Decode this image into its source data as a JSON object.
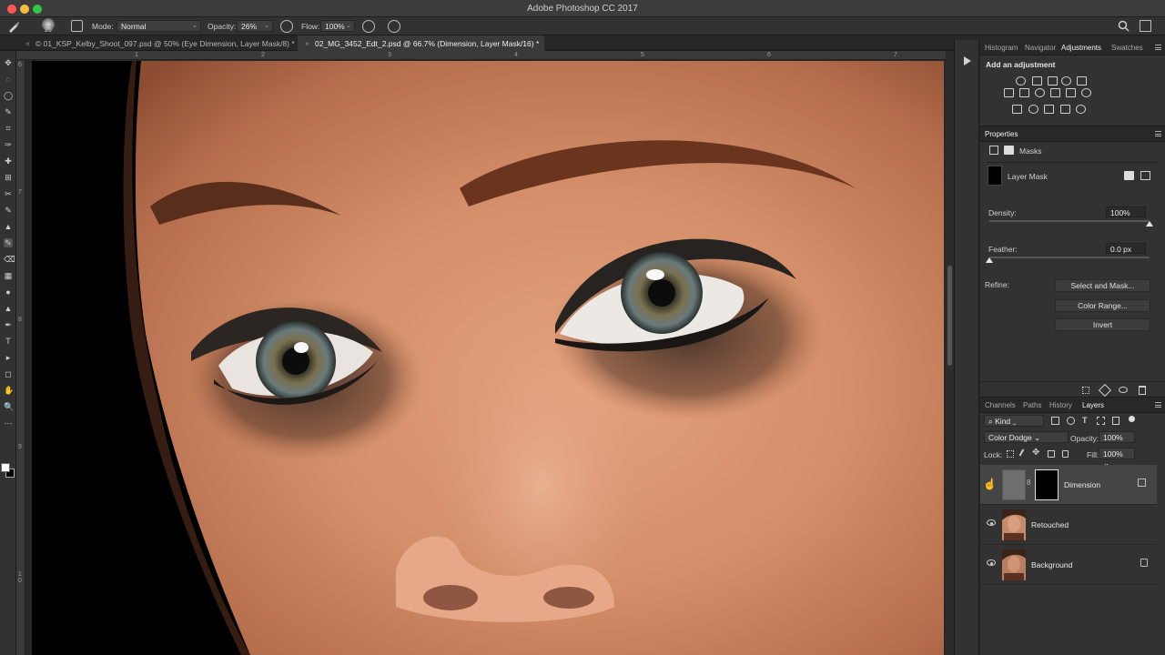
{
  "app": {
    "title": "Adobe Photoshop CC 2017"
  },
  "options_bar": {
    "brush_size": "25",
    "mode_label": "Mode:",
    "mode_value": "Normal",
    "opacity_label": "Opacity:",
    "opacity_value": "26%",
    "flow_label": "Flow:",
    "flow_value": "100%"
  },
  "documents": [
    {
      "close": "×",
      "label": "© 01_KSP_Kelby_Shoot_097.psd @ 50% (Eye Dimension, Layer Mask/8) *"
    },
    {
      "close": "×",
      "label": "02_MG_3452_Edt_2.psd @ 66.7% (Dimension, Layer Mask/16) *"
    }
  ],
  "rulers": {
    "top": [
      "1",
      "2",
      "3",
      "4",
      "5",
      "6",
      "7"
    ],
    "left": [
      "6",
      "7",
      "8",
      "9",
      "1 0"
    ]
  },
  "tools": [
    "✥",
    "◌",
    "◯",
    "✎",
    "⌗",
    "✑",
    "✚",
    "⊞",
    "✂",
    "✎",
    "▲",
    "✎",
    "⌫",
    "▦",
    "●",
    "▲",
    "✒",
    "T",
    "▸",
    "◻",
    "✋",
    "🔍",
    "⋯"
  ],
  "adjustments_panel": {
    "tabs": [
      "Histogram",
      "Navigator",
      "Adjustments",
      "Swatches"
    ],
    "active_tab": "Adjustments",
    "heading": "Add an adjustment"
  },
  "properties_panel": {
    "tab": "Properties",
    "section": "Masks",
    "mask_name": "Layer Mask",
    "density_label": "Density:",
    "density_value": "100%",
    "density_level": 1.0,
    "feather_label": "Feather:",
    "feather_value": "0.0 px",
    "feather_level": 0.0,
    "refine_label": "Refine:",
    "buttons": [
      "Select and Mask...",
      "Color Range...",
      "Invert"
    ]
  },
  "layers_panel": {
    "tabs": [
      "Channels",
      "Paths",
      "History",
      "Layers"
    ],
    "active_tab": "Layers",
    "filter_kind": "Kind",
    "blend_mode": "Color Dodge",
    "opacity_label": "Opacity:",
    "opacity_value": "100%",
    "lock_label": "Lock:",
    "fill_label": "Fill:",
    "fill_value": "100%",
    "layers": [
      {
        "name": "Dimension",
        "selected": true,
        "visible": false
      },
      {
        "name": "Retouched",
        "selected": false,
        "visible": true
      },
      {
        "name": "Background",
        "selected": false,
        "visible": true,
        "locked": true
      }
    ]
  },
  "colors": {
    "foreground": "#ffffff",
    "background": "#000000",
    "accent_selected_layer": "#454545"
  }
}
